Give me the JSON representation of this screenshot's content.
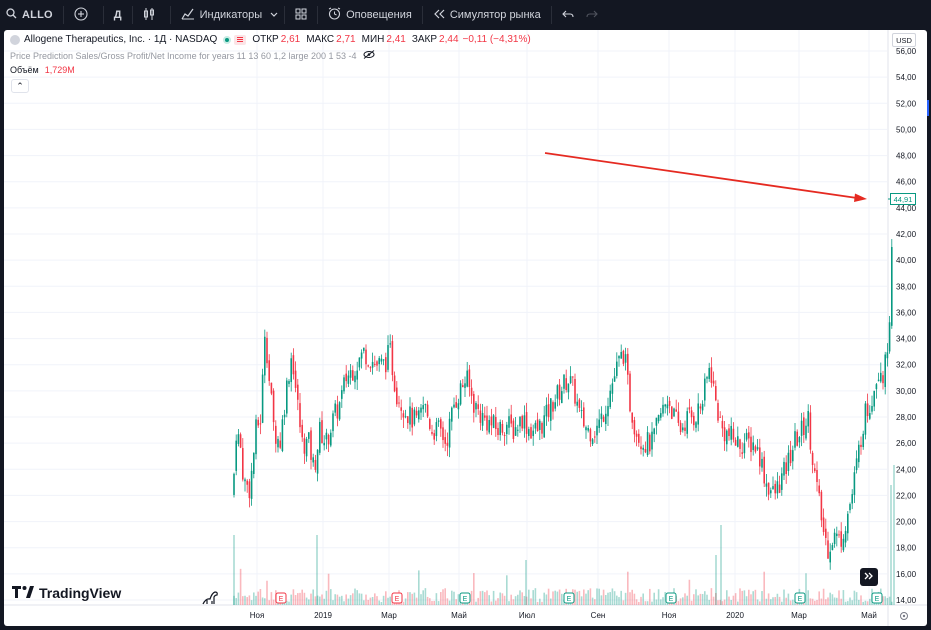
{
  "toolbar": {
    "symbol": "ALLO",
    "interval": "Д",
    "indicators_label": "Индикаторы",
    "alerts_label": "Оповещения",
    "replay_label": "Симулятор рынка"
  },
  "legend": {
    "title": "Allogene Therapeutics, Inc. · 1Д · NASDAQ",
    "open_label": "ОТКР",
    "open": "2,61",
    "high_label": "МАКС",
    "high": "2,71",
    "low_label": "МИН",
    "low": "2,41",
    "close_label": "ЗАКР",
    "close": "2,44",
    "change": "−0,11 (−4,31%)",
    "indicator": "Price Prediction Sales/Gross Profit/Net Income for years 11 13 60 1,2 large 200 1 53 -4",
    "volume_label": "Объём",
    "volume": "1,729M",
    "collapse_glyph": "⌃"
  },
  "price_axis": {
    "currency": "USD",
    "labels": [
      "56,00",
      "54,00",
      "52,00",
      "50,00",
      "48,00",
      "46,00",
      "44,00",
      "42,00",
      "40,00",
      "38,00",
      "36,00",
      "34,00",
      "32,00",
      "30,00",
      "28,00",
      "26,00",
      "24,00",
      "22,00",
      "20,00",
      "18,00",
      "16,00",
      "14,00"
    ],
    "last_price": "44,91"
  },
  "time_axis": {
    "labels": [
      "Ноя",
      "2019",
      "Мар",
      "Май",
      "Июл",
      "Сен",
      "Ноя",
      "2020",
      "Мар",
      "Май"
    ]
  },
  "earnings_marker": "E",
  "logo_text": "TradingView",
  "colors": {
    "up": "#089981",
    "down": "#f23645",
    "arrow": "#e52a21",
    "background": "#131722"
  },
  "icons": [
    "search-icon",
    "add-symbol-icon",
    "bars-style-icon",
    "indicators-icon",
    "chevron-down-icon",
    "layout-icon",
    "alarm-icon",
    "replay-icon",
    "undo-icon",
    "redo-icon",
    "eye-off-icon",
    "dino-icon",
    "scroll-right-icon",
    "settings-icon"
  ]
}
